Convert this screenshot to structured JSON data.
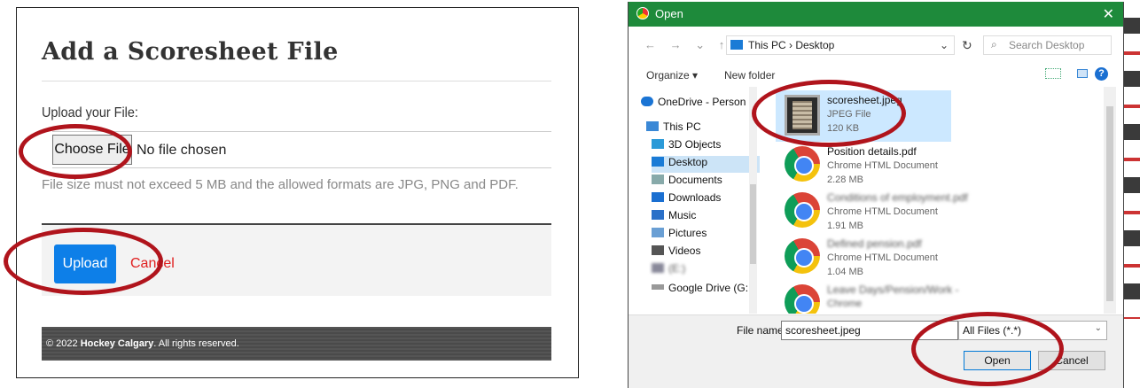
{
  "left": {
    "title": "Add a Scoresheet File",
    "upload_label": "Upload your File:",
    "choose_file_button": "Choose File",
    "no_file_text": "No file chosen",
    "hint": "File size must not exceed 5 MB and the allowed formats are JPG, PNG and PDF.",
    "upload_button": "Upload",
    "cancel_link": "Cancel",
    "copyright_prefix": "© 2022 ",
    "copyright_brand": "Hockey Calgary",
    "copyright_suffix": ". All rights reserved."
  },
  "dialog": {
    "title": "Open",
    "close": "✕",
    "nav_arrows": "← → ⌄ ↑",
    "path": "This PC  ›  Desktop",
    "path_dropdown": "⌄",
    "refresh": "↻",
    "search_placeholder": "Search Desktop",
    "search_icon": "⌕",
    "organize": "Organize ▾",
    "new_folder": "New folder",
    "help": "?",
    "nav_items": [
      {
        "label": "OneDrive - Person",
        "icon": "cloud-icon",
        "color": "#1a74d4"
      },
      {
        "label": "This PC",
        "icon": "pc-icon",
        "color": "#3a88d6"
      },
      {
        "label": "3D Objects",
        "icon": "cube-icon",
        "color": "#2b9ad8"
      },
      {
        "label": "Desktop",
        "icon": "desktop-icon",
        "color": "#1a7bd6"
      },
      {
        "label": "Documents",
        "icon": "documents-icon",
        "color": "#8aa"
      },
      {
        "label": "Downloads",
        "icon": "download-icon",
        "color": "#1a6fd1"
      },
      {
        "label": "Music",
        "icon": "music-icon",
        "color": "#2a70c8"
      },
      {
        "label": "Pictures",
        "icon": "pictures-icon",
        "color": "#6a9fd4"
      },
      {
        "label": "Videos",
        "icon": "videos-icon",
        "color": "#555"
      },
      {
        "label": "(E:)",
        "icon": "drive-icon",
        "color": "#889"
      },
      {
        "label": "Google Drive (G:",
        "icon": "drive-icon",
        "color": "#999"
      }
    ],
    "files": [
      {
        "name": "scoresheet.jpeg",
        "type": "JPEG File",
        "size": "120 KB",
        "icon": "image-thumbnail",
        "selected": true
      },
      {
        "name": "Position details.pdf",
        "type": "Chrome HTML Document",
        "size": "2.28 MB",
        "icon": "chrome-icon"
      },
      {
        "name": "Conditions of employment.pdf",
        "type": "Chrome HTML Document",
        "size": "1.91 MB",
        "icon": "chrome-icon"
      },
      {
        "name": "Defined pension.pdf",
        "type": "Chrome HTML Document",
        "size": "1.04 MB",
        "icon": "chrome-icon"
      },
      {
        "name": "Leave Days/Pension/Work -",
        "type": "Chrome",
        "size": "",
        "icon": "chrome-icon"
      }
    ],
    "file_name_label": "File name:",
    "file_name_value": "scoresheet.jpeg",
    "filter_value": "All Files (*.*)",
    "open_button": "Open",
    "cancel_button": "Cancel"
  },
  "annotation_color": "#b0141c"
}
